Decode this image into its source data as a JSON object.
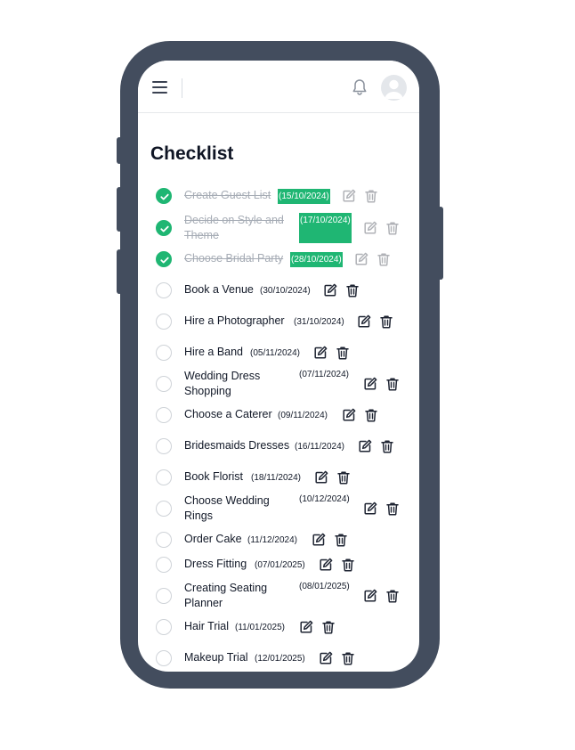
{
  "page": {
    "title": "Checklist"
  },
  "header": {
    "menu_icon": "hamburger-menu-icon",
    "bell_icon": "bell-icon",
    "avatar_icon": "user-avatar-icon"
  },
  "colors": {
    "accent": "#1fb673",
    "frame": "#434d5e",
    "text": "#111827",
    "muted": "#a6acb5"
  },
  "tasks": [
    {
      "label": "Create Guest List",
      "date": "(15/10/2024)",
      "completed": true
    },
    {
      "label": "Decide on Style and Theme",
      "date": "(17/10/2024)",
      "completed": true
    },
    {
      "label": "Choose Bridal Party",
      "date": "(28/10/2024)",
      "completed": true
    },
    {
      "label": "Book a Venue",
      "date": "(30/10/2024)",
      "completed": false
    },
    {
      "label": "Hire a Photographer",
      "date": "(31/10/2024)",
      "completed": false
    },
    {
      "label": "Hire a Band",
      "date": "(05/11/2024)",
      "completed": false
    },
    {
      "label": "Wedding Dress Shopping",
      "date": "(07/11/2024)",
      "completed": false
    },
    {
      "label": "Choose a Caterer",
      "date": "(09/11/2024)",
      "completed": false
    },
    {
      "label": "Bridesmaids Dresses",
      "date": "(16/11/2024)",
      "completed": false
    },
    {
      "label": "Book Florist",
      "date": "(18/11/2024)",
      "completed": false
    },
    {
      "label": "Choose Wedding Rings",
      "date": "(10/12/2024)",
      "completed": false
    },
    {
      "label": "Order Cake",
      "date": "(11/12/2024)",
      "completed": false
    },
    {
      "label": "Dress Fitting",
      "date": "(07/01/2025)",
      "completed": false
    },
    {
      "label": "Creating Seating Planner",
      "date": "(08/01/2025)",
      "completed": false
    },
    {
      "label": "Hair Trial",
      "date": "(11/01/2025)",
      "completed": false
    },
    {
      "label": "Makeup Trial",
      "date": "(12/01/2025)",
      "completed": false
    }
  ]
}
